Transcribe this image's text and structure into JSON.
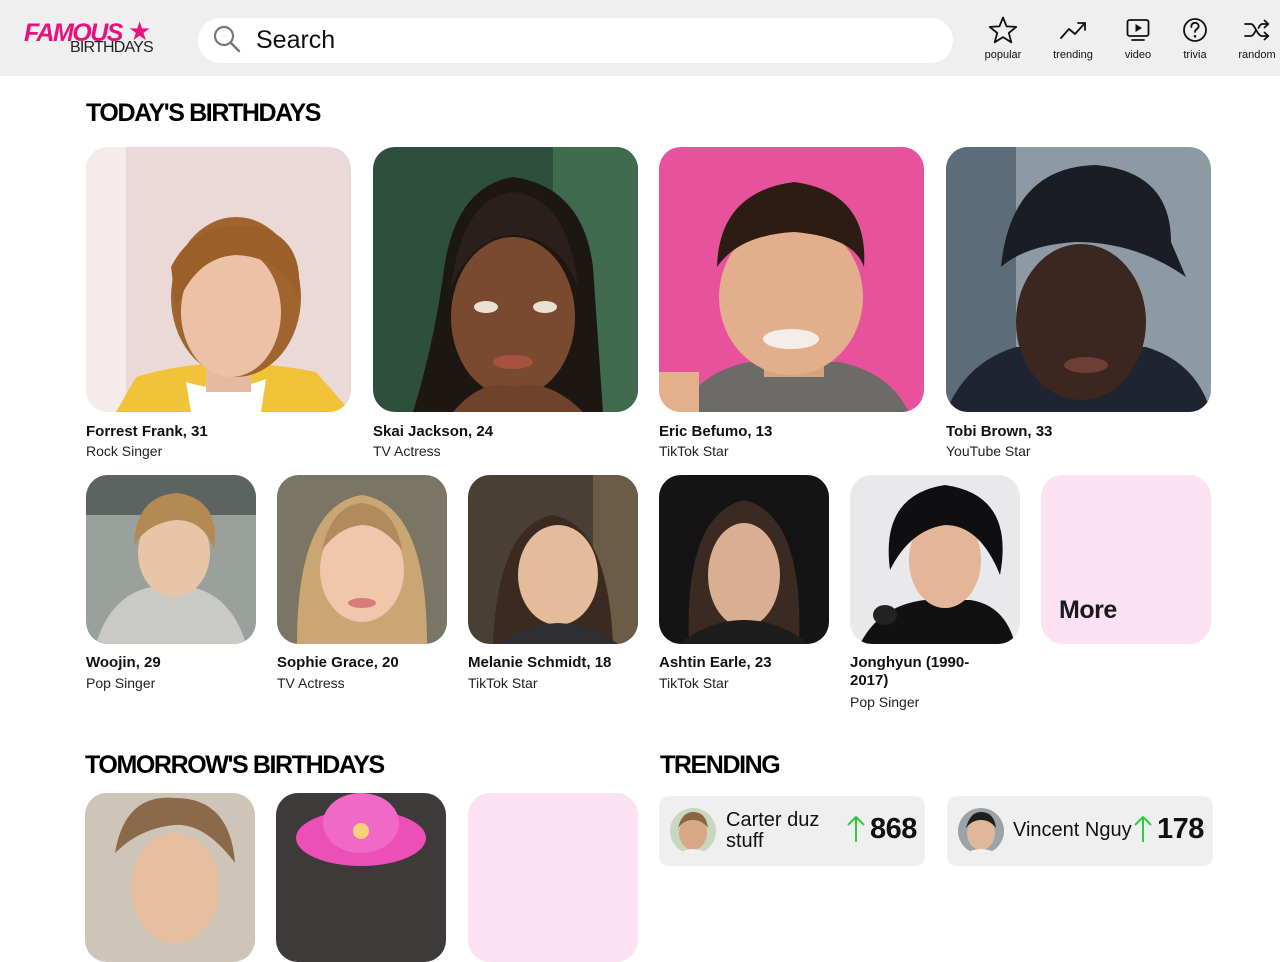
{
  "header": {
    "logo_top": "FAMOUS",
    "logo_bottom": "BIRTHDAYS",
    "search_placeholder": "Search",
    "nav": [
      {
        "label": "popular",
        "icon": "star-icon"
      },
      {
        "label": "trending",
        "icon": "trending-icon"
      },
      {
        "label": "video",
        "icon": "video-icon"
      },
      {
        "label": "trivia",
        "icon": "question-icon"
      },
      {
        "label": "random",
        "icon": "shuffle-icon"
      }
    ]
  },
  "today": {
    "title": "TODAY'S BIRTHDAYS",
    "featured": [
      {
        "name": "Forrest Frank, 31",
        "job": "Rock Singer"
      },
      {
        "name": "Skai Jackson, 24",
        "job": "TV Actress"
      },
      {
        "name": "Eric Befumo, 13",
        "job": "TikTok Star"
      },
      {
        "name": "Tobi Brown, 33",
        "job": "YouTube Star"
      }
    ],
    "small": [
      {
        "name": "Woojin, 29",
        "job": "Pop Singer"
      },
      {
        "name": "Sophie Grace, 20",
        "job": "TV Actress"
      },
      {
        "name": "Melanie Schmidt, 18",
        "job": "TikTok Star"
      },
      {
        "name": "Ashtin Earle, 23",
        "job": "TikTok Star"
      },
      {
        "name": "Jonghyun (1990-\n2017)",
        "job": "Pop Singer"
      }
    ],
    "more_label": "More"
  },
  "tomorrow": {
    "title": "TOMORROW'S BIRTHDAYS"
  },
  "trending": {
    "title": "TRENDING",
    "items": [
      {
        "name": "Carter duz\nstuff",
        "count": "868"
      },
      {
        "name": "Vincent Nguy",
        "count": "178"
      }
    ]
  },
  "colors": {
    "brand_pink": "#e8127c",
    "header_bg": "#f0eff0",
    "more_tile_bg": "#fce1f2",
    "trend_arrow_green": "#2ecc40"
  }
}
